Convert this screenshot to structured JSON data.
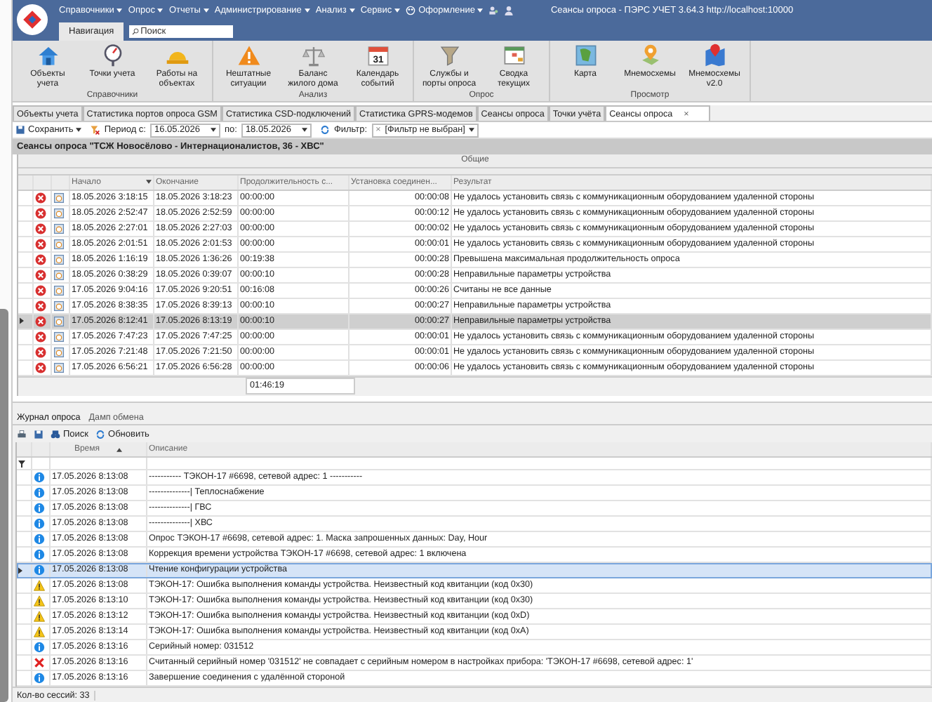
{
  "window": {
    "title": "Сеансы опроса - ПЭРС УЧЕТ 3.64.3 http://localhost:10000"
  },
  "menu": [
    {
      "label": "Справочники",
      "kind": "plain"
    },
    {
      "label": "Опрос",
      "kind": "plain"
    },
    {
      "label": "Отчеты",
      "kind": "plain"
    },
    {
      "label": "Администрирование",
      "kind": "plain"
    },
    {
      "label": "Анализ",
      "kind": "plain"
    },
    {
      "label": "Сервис",
      "kind": "plain"
    },
    {
      "label": "Оформление",
      "kind": "palette"
    }
  ],
  "nav_tab": "Навигация",
  "search": {
    "placeholder": "Поиск"
  },
  "ribbon": [
    {
      "label": "Справочники",
      "buttons": [
        {
          "label": "Объекты\nучета",
          "kind": "house"
        },
        {
          "label": "Точки учета",
          "kind": "gauge"
        },
        {
          "label": "Работы на\nобъектах",
          "kind": "helmet"
        }
      ]
    },
    {
      "label": "Анализ",
      "buttons": [
        {
          "label": "Нештатные\nситуации",
          "kind": "warning"
        },
        {
          "label": "Баланс\nжилого дома",
          "kind": "scales"
        },
        {
          "label": "Календарь\nсобытий",
          "kind": "calendar",
          "icon_text": "31"
        }
      ]
    },
    {
      "label": "Опрос",
      "buttons": [
        {
          "label": "Службы и\nпорты опроса",
          "kind": "funnel"
        },
        {
          "label": "Сводка\nтекущих",
          "kind": "table"
        }
      ]
    },
    {
      "label": "Просмотр",
      "buttons": [
        {
          "label": "Карта",
          "kind": "map"
        },
        {
          "label": "Мнемосхемы",
          "kind": "pin"
        },
        {
          "label": "Мнемосхемы\nv2.0",
          "kind": "pinmap"
        }
      ]
    }
  ],
  "doc_tabs": [
    {
      "label": "Объекты учета",
      "selected": false
    },
    {
      "label": "Статистика портов опроса GSM",
      "selected": false
    },
    {
      "label": "Статистика CSD-подключений",
      "selected": false
    },
    {
      "label": "Статистика GPRS-модемов",
      "selected": false
    },
    {
      "label": "Сеансы опроса",
      "selected": false
    },
    {
      "label": "Точки учёта",
      "selected": false
    },
    {
      "label": "Сеансы опроса",
      "selected": true,
      "close": "×"
    }
  ],
  "toolbar": {
    "save": "Сохранить",
    "period_from_label": "Период с:",
    "period_from": "16.05.2026",
    "period_to_label": "по:",
    "period_to": "18.05.2026",
    "filter_label": "Фильтр:",
    "filter_clear": "×",
    "filter_value": "[Фильтр не выбран]"
  },
  "sessions": {
    "title": "Сеансы опроса \"ТСЖ Новосёлово - Интернационалистов, 36 - ХВС\"",
    "band": "Общие",
    "columns": [
      "Начало",
      "Окончание",
      "Продолжительность с...",
      "Установка соединен...",
      "Результат"
    ],
    "rows": [
      {
        "kind": "error",
        "selected": false,
        "cells": [
          "18.05.2026 3:18:15",
          "18.05.2026 3:18:23",
          "00:00:00",
          "00:00:08",
          "Не удалось установить связь с коммуникационным оборудованием удаленной стороны"
        ]
      },
      {
        "kind": "error",
        "selected": false,
        "cells": [
          "18.05.2026 2:52:47",
          "18.05.2026 2:52:59",
          "00:00:00",
          "00:00:12",
          "Не удалось установить связь с коммуникационным оборудованием удаленной стороны"
        ]
      },
      {
        "kind": "error",
        "selected": false,
        "cells": [
          "18.05.2026 2:27:01",
          "18.05.2026 2:27:03",
          "00:00:00",
          "00:00:02",
          "Не удалось установить связь с коммуникационным оборудованием удаленной стороны"
        ]
      },
      {
        "kind": "error",
        "selected": false,
        "cells": [
          "18.05.2026 2:01:51",
          "18.05.2026 2:01:53",
          "00:00:00",
          "00:00:01",
          "Не удалось установить связь с коммуникационным оборудованием удаленной стороны"
        ]
      },
      {
        "kind": "error",
        "selected": false,
        "cells": [
          "18.05.2026 1:16:19",
          "18.05.2026 1:36:26",
          "00:19:38",
          "00:00:28",
          "Превышена максимальная продолжительность опроса"
        ]
      },
      {
        "kind": "error",
        "selected": false,
        "cells": [
          "18.05.2026 0:38:29",
          "18.05.2026 0:39:07",
          "00:00:10",
          "00:00:28",
          "Неправильные параметры устройства"
        ]
      },
      {
        "kind": "error",
        "selected": false,
        "cells": [
          "17.05.2026 9:04:16",
          "17.05.2026 9:20:51",
          "00:16:08",
          "00:00:26",
          "Считаны не все данные"
        ]
      },
      {
        "kind": "error",
        "selected": false,
        "cells": [
          "17.05.2026 8:38:35",
          "17.05.2026 8:39:13",
          "00:00:10",
          "00:00:27",
          "Неправильные параметры устройства"
        ]
      },
      {
        "kind": "error",
        "selected": true,
        "cells": [
          "17.05.2026 8:12:41",
          "17.05.2026 8:13:19",
          "00:00:10",
          "00:00:27",
          "Неправильные параметры устройства"
        ]
      },
      {
        "kind": "error",
        "selected": false,
        "cells": [
          "17.05.2026 7:47:23",
          "17.05.2026 7:47:25",
          "00:00:00",
          "00:00:01",
          "Не удалось установить связь с коммуникационным оборудованием удаленной стороны"
        ]
      },
      {
        "kind": "error",
        "selected": false,
        "cells": [
          "17.05.2026 7:21:48",
          "17.05.2026 7:21:50",
          "00:00:00",
          "00:00:01",
          "Не удалось установить связь с коммуникационным оборудованием удаленной стороны"
        ]
      },
      {
        "kind": "error",
        "selected": false,
        "cells": [
          "17.05.2026 6:56:21",
          "17.05.2026 6:56:28",
          "00:00:00",
          "00:00:06",
          "Не удалось установить связь с коммуникационным оборудованием удаленной стороны"
        ]
      }
    ],
    "total": "01:46:19"
  },
  "log_tabs": [
    {
      "label": "Журнал опроса",
      "selected": true
    },
    {
      "label": "Дамп обмена",
      "selected": false
    }
  ],
  "log_toolbar": {
    "search": "Поиск",
    "refresh": "Обновить"
  },
  "log": {
    "columns": [
      "Время",
      "Описание"
    ],
    "rows": [
      {
        "kind": "info",
        "selected": false,
        "time": "17.05.2026 8:13:08",
        "text": "----------- ТЭКОН-17 #6698, сетевой адрес: 1 -----------"
      },
      {
        "kind": "info",
        "selected": false,
        "time": "17.05.2026 8:13:08",
        "text": "--------------| Теплоснабжение"
      },
      {
        "kind": "info",
        "selected": false,
        "time": "17.05.2026 8:13:08",
        "text": "--------------| ГВС"
      },
      {
        "kind": "info",
        "selected": false,
        "time": "17.05.2026 8:13:08",
        "text": "--------------| ХВС"
      },
      {
        "kind": "info",
        "selected": false,
        "time": "17.05.2026 8:13:08",
        "text": "Опрос ТЭКОН-17 #6698, сетевой адрес: 1. Маска запрошенных данных: Day, Hour"
      },
      {
        "kind": "info",
        "selected": false,
        "time": "17.05.2026 8:13:08",
        "text": "Коррекция времени устройства ТЭКОН-17 #6698, сетевой адрес: 1 включена"
      },
      {
        "kind": "info",
        "selected": true,
        "time": "17.05.2026 8:13:08",
        "text": "Чтение конфигурации устройства"
      },
      {
        "kind": "warning",
        "selected": false,
        "time": "17.05.2026 8:13:08",
        "text": "ТЭКОН-17: Ошибка выполнения команды устройства. Неизвестный код квитанции (код 0x30)"
      },
      {
        "kind": "warning",
        "selected": false,
        "time": "17.05.2026 8:13:10",
        "text": "ТЭКОН-17: Ошибка выполнения команды устройства. Неизвестный код квитанции (код 0x30)"
      },
      {
        "kind": "warning",
        "selected": false,
        "time": "17.05.2026 8:13:12",
        "text": "ТЭКОН-17: Ошибка выполнения команды устройства. Неизвестный код квитанции (код 0xD)"
      },
      {
        "kind": "warning",
        "selected": false,
        "time": "17.05.2026 8:13:14",
        "text": "ТЭКОН-17: Ошибка выполнения команды устройства. Неизвестный код квитанции (код 0xA)"
      },
      {
        "kind": "info",
        "selected": false,
        "time": "17.05.2026 8:13:16",
        "text": "Серийный номер: 031512"
      },
      {
        "kind": "error",
        "selected": false,
        "time": "17.05.2026 8:13:16",
        "text": "Считанный серийный номер '031512' не совпадает с серийным номером в настройках прибора: 'ТЭКОН-17 #6698, сетевой адрес: 1'"
      },
      {
        "kind": "info",
        "selected": false,
        "time": "17.05.2026 8:13:16",
        "text": "Завершение соединения с удалённой стороной"
      }
    ]
  },
  "status_bar": "Кол-во сессий: 33"
}
